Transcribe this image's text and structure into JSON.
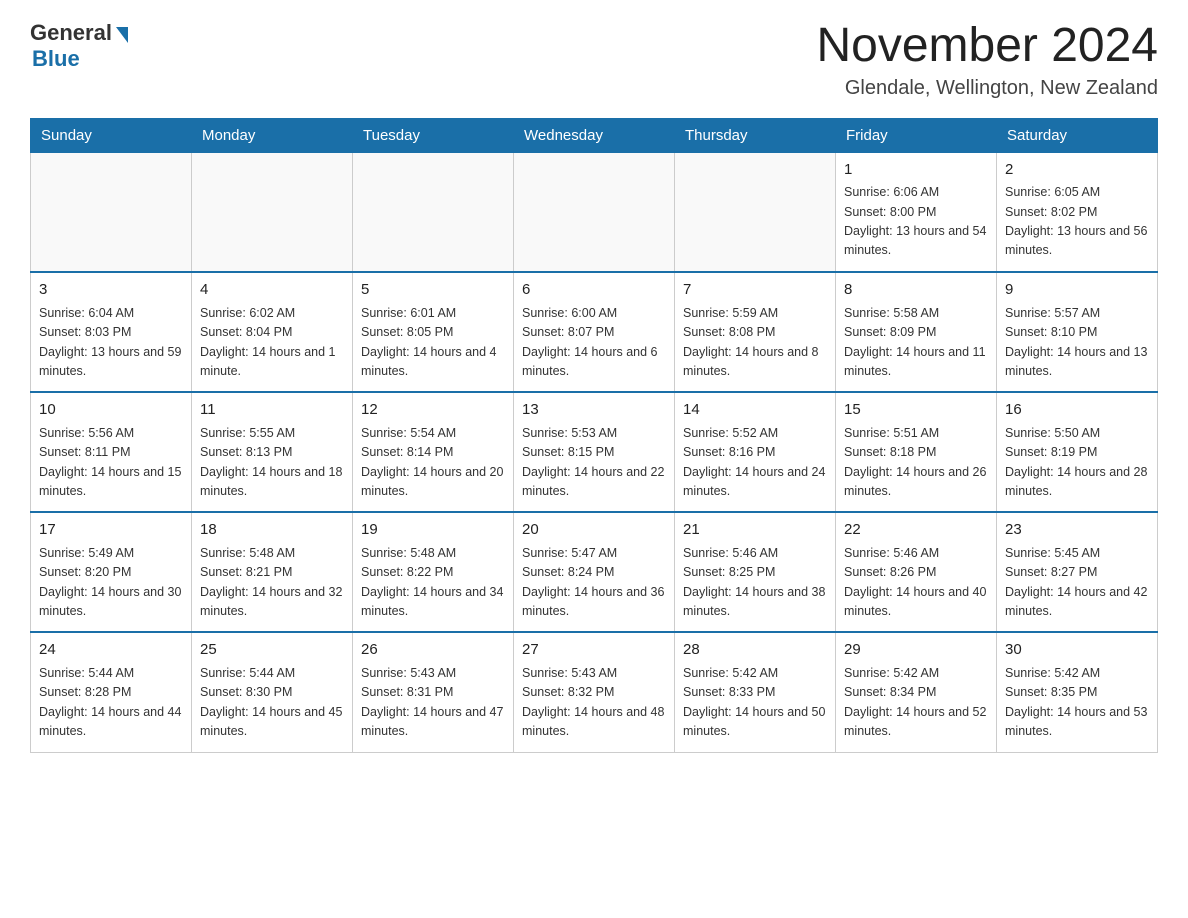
{
  "header": {
    "logo_general": "General",
    "logo_blue": "Blue",
    "month_title": "November 2024",
    "location": "Glendale, Wellington, New Zealand"
  },
  "days_of_week": [
    "Sunday",
    "Monday",
    "Tuesday",
    "Wednesday",
    "Thursday",
    "Friday",
    "Saturday"
  ],
  "weeks": [
    [
      {
        "day": "",
        "sunrise": "",
        "sunset": "",
        "daylight": ""
      },
      {
        "day": "",
        "sunrise": "",
        "sunset": "",
        "daylight": ""
      },
      {
        "day": "",
        "sunrise": "",
        "sunset": "",
        "daylight": ""
      },
      {
        "day": "",
        "sunrise": "",
        "sunset": "",
        "daylight": ""
      },
      {
        "day": "",
        "sunrise": "",
        "sunset": "",
        "daylight": ""
      },
      {
        "day": "1",
        "sunrise": "Sunrise: 6:06 AM",
        "sunset": "Sunset: 8:00 PM",
        "daylight": "Daylight: 13 hours and 54 minutes."
      },
      {
        "day": "2",
        "sunrise": "Sunrise: 6:05 AM",
        "sunset": "Sunset: 8:02 PM",
        "daylight": "Daylight: 13 hours and 56 minutes."
      }
    ],
    [
      {
        "day": "3",
        "sunrise": "Sunrise: 6:04 AM",
        "sunset": "Sunset: 8:03 PM",
        "daylight": "Daylight: 13 hours and 59 minutes."
      },
      {
        "day": "4",
        "sunrise": "Sunrise: 6:02 AM",
        "sunset": "Sunset: 8:04 PM",
        "daylight": "Daylight: 14 hours and 1 minute."
      },
      {
        "day": "5",
        "sunrise": "Sunrise: 6:01 AM",
        "sunset": "Sunset: 8:05 PM",
        "daylight": "Daylight: 14 hours and 4 minutes."
      },
      {
        "day": "6",
        "sunrise": "Sunrise: 6:00 AM",
        "sunset": "Sunset: 8:07 PM",
        "daylight": "Daylight: 14 hours and 6 minutes."
      },
      {
        "day": "7",
        "sunrise": "Sunrise: 5:59 AM",
        "sunset": "Sunset: 8:08 PM",
        "daylight": "Daylight: 14 hours and 8 minutes."
      },
      {
        "day": "8",
        "sunrise": "Sunrise: 5:58 AM",
        "sunset": "Sunset: 8:09 PM",
        "daylight": "Daylight: 14 hours and 11 minutes."
      },
      {
        "day": "9",
        "sunrise": "Sunrise: 5:57 AM",
        "sunset": "Sunset: 8:10 PM",
        "daylight": "Daylight: 14 hours and 13 minutes."
      }
    ],
    [
      {
        "day": "10",
        "sunrise": "Sunrise: 5:56 AM",
        "sunset": "Sunset: 8:11 PM",
        "daylight": "Daylight: 14 hours and 15 minutes."
      },
      {
        "day": "11",
        "sunrise": "Sunrise: 5:55 AM",
        "sunset": "Sunset: 8:13 PM",
        "daylight": "Daylight: 14 hours and 18 minutes."
      },
      {
        "day": "12",
        "sunrise": "Sunrise: 5:54 AM",
        "sunset": "Sunset: 8:14 PM",
        "daylight": "Daylight: 14 hours and 20 minutes."
      },
      {
        "day": "13",
        "sunrise": "Sunrise: 5:53 AM",
        "sunset": "Sunset: 8:15 PM",
        "daylight": "Daylight: 14 hours and 22 minutes."
      },
      {
        "day": "14",
        "sunrise": "Sunrise: 5:52 AM",
        "sunset": "Sunset: 8:16 PM",
        "daylight": "Daylight: 14 hours and 24 minutes."
      },
      {
        "day": "15",
        "sunrise": "Sunrise: 5:51 AM",
        "sunset": "Sunset: 8:18 PM",
        "daylight": "Daylight: 14 hours and 26 minutes."
      },
      {
        "day": "16",
        "sunrise": "Sunrise: 5:50 AM",
        "sunset": "Sunset: 8:19 PM",
        "daylight": "Daylight: 14 hours and 28 minutes."
      }
    ],
    [
      {
        "day": "17",
        "sunrise": "Sunrise: 5:49 AM",
        "sunset": "Sunset: 8:20 PM",
        "daylight": "Daylight: 14 hours and 30 minutes."
      },
      {
        "day": "18",
        "sunrise": "Sunrise: 5:48 AM",
        "sunset": "Sunset: 8:21 PM",
        "daylight": "Daylight: 14 hours and 32 minutes."
      },
      {
        "day": "19",
        "sunrise": "Sunrise: 5:48 AM",
        "sunset": "Sunset: 8:22 PM",
        "daylight": "Daylight: 14 hours and 34 minutes."
      },
      {
        "day": "20",
        "sunrise": "Sunrise: 5:47 AM",
        "sunset": "Sunset: 8:24 PM",
        "daylight": "Daylight: 14 hours and 36 minutes."
      },
      {
        "day": "21",
        "sunrise": "Sunrise: 5:46 AM",
        "sunset": "Sunset: 8:25 PM",
        "daylight": "Daylight: 14 hours and 38 minutes."
      },
      {
        "day": "22",
        "sunrise": "Sunrise: 5:46 AM",
        "sunset": "Sunset: 8:26 PM",
        "daylight": "Daylight: 14 hours and 40 minutes."
      },
      {
        "day": "23",
        "sunrise": "Sunrise: 5:45 AM",
        "sunset": "Sunset: 8:27 PM",
        "daylight": "Daylight: 14 hours and 42 minutes."
      }
    ],
    [
      {
        "day": "24",
        "sunrise": "Sunrise: 5:44 AM",
        "sunset": "Sunset: 8:28 PM",
        "daylight": "Daylight: 14 hours and 44 minutes."
      },
      {
        "day": "25",
        "sunrise": "Sunrise: 5:44 AM",
        "sunset": "Sunset: 8:30 PM",
        "daylight": "Daylight: 14 hours and 45 minutes."
      },
      {
        "day": "26",
        "sunrise": "Sunrise: 5:43 AM",
        "sunset": "Sunset: 8:31 PM",
        "daylight": "Daylight: 14 hours and 47 minutes."
      },
      {
        "day": "27",
        "sunrise": "Sunrise: 5:43 AM",
        "sunset": "Sunset: 8:32 PM",
        "daylight": "Daylight: 14 hours and 48 minutes."
      },
      {
        "day": "28",
        "sunrise": "Sunrise: 5:42 AM",
        "sunset": "Sunset: 8:33 PM",
        "daylight": "Daylight: 14 hours and 50 minutes."
      },
      {
        "day": "29",
        "sunrise": "Sunrise: 5:42 AM",
        "sunset": "Sunset: 8:34 PM",
        "daylight": "Daylight: 14 hours and 52 minutes."
      },
      {
        "day": "30",
        "sunrise": "Sunrise: 5:42 AM",
        "sunset": "Sunset: 8:35 PM",
        "daylight": "Daylight: 14 hours and 53 minutes."
      }
    ]
  ]
}
